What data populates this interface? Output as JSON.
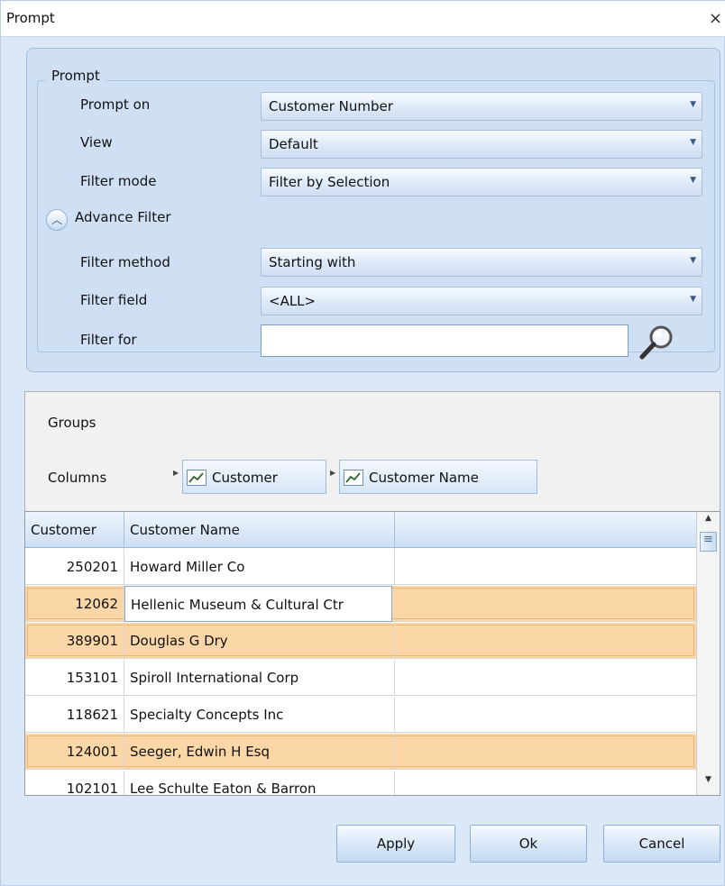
{
  "window": {
    "title": "Prompt",
    "close_glyph": "×"
  },
  "prompt_group": {
    "legend": "Prompt",
    "prompt_on": {
      "label": "Prompt on",
      "value": "Customer Number"
    },
    "view": {
      "label": "View",
      "value": "Default"
    },
    "filter_mode": {
      "label": "Filter mode",
      "value": "Filter by Selection"
    },
    "advance_filter": {
      "label": "Advance Filter",
      "icon": "chevron-up-icon"
    },
    "filter_method": {
      "label": "Filter method",
      "value": "Starting with"
    },
    "filter_field": {
      "label": "Filter field",
      "value": "<ALL>"
    },
    "filter_for": {
      "label": "Filter for",
      "value": ""
    }
  },
  "grouping": {
    "groups_label": "Groups",
    "columns_label": "Columns",
    "columns": [
      "Customer",
      "Customer Name"
    ]
  },
  "grid": {
    "headers": [
      "Customer",
      "Customer Name",
      ""
    ],
    "rows": [
      {
        "customer": "250201",
        "name": "Howard Miller Co",
        "selected": false
      },
      {
        "customer": "12062",
        "name": "Hellenic Museum & Cultural Ctr",
        "selected": true
      },
      {
        "customer": "389901",
        "name": "Douglas G Dry",
        "selected": true
      },
      {
        "customer": "153101",
        "name": "Spiroll International Corp",
        "selected": false
      },
      {
        "customer": "118621",
        "name": "Specialty Concepts Inc",
        "selected": false
      },
      {
        "customer": "124001",
        "name": "Seeger, Edwin H Esq",
        "selected": true
      },
      {
        "customer": "102101",
        "name": "Lee Schulte Eaton & Barron",
        "selected": false
      }
    ]
  },
  "buttons": {
    "apply": "Apply",
    "ok": "Ok",
    "cancel": "Cancel"
  },
  "colors": {
    "selected_row": "#fbd6a6",
    "panel": "#cfe0f4"
  }
}
